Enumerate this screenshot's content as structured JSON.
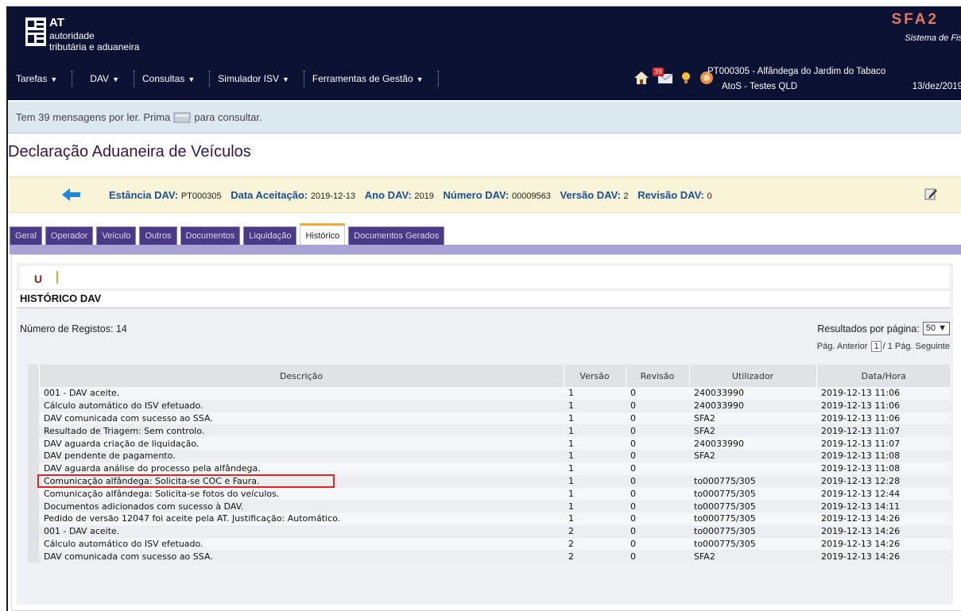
{
  "header": {
    "brand_short": "AT",
    "brand_line1": "autoridade",
    "brand_line2": "tributária e aduaneira",
    "app_title": "SFA2",
    "app_subtitle": "Sistema de Fis",
    "menu": [
      {
        "label": "Tarefas"
      },
      {
        "label": "DAV"
      },
      {
        "label": "Consultas"
      },
      {
        "label": "Simulador ISV"
      },
      {
        "label": "Ferramentas de Gestão"
      }
    ],
    "message_badge": "39",
    "user_line1": "PT000305 - Alfândega do Jardim do Tabaco",
    "user_line2": "AtoS - Testes QLD",
    "date": "13/dez/2019",
    "icons": [
      "home-icon",
      "mail-icon",
      "bulb-icon",
      "help-icon"
    ],
    "colors": {
      "topbar": "#0b1233",
      "app_title": "#e07a5f"
    }
  },
  "message_bar": {
    "text_before": "Tem 39 mensagens por ler. Prima",
    "text_after": "para consultar."
  },
  "page_title": "Declaração Aduaneira de Veículos",
  "info": {
    "estancia_label": "Estância DAV:",
    "estancia": "PT000305",
    "data_label": "Data Aceitação:",
    "data": "2019-12-13",
    "ano_label": "Ano DAV:",
    "ano": "2019",
    "numero_label": "Número DAV:",
    "numero": "00009563",
    "versao_label": "Versão DAV:",
    "versao": "2",
    "revisao_label": "Revisão DAV:",
    "revisao": "0"
  },
  "tabs": [
    {
      "label": "Geral"
    },
    {
      "label": "Operador"
    },
    {
      "label": "Veículo"
    },
    {
      "label": "Outros"
    },
    {
      "label": "Documentos"
    },
    {
      "label": "Liquidação"
    },
    {
      "label": "Histórico",
      "active": true
    },
    {
      "label": "Documentos Gerados"
    }
  ],
  "history": {
    "marker": "U",
    "title": "HISTÓRICO DAV",
    "record_count": "Número de Registos: 14",
    "per_page_label": "Resultados por página:",
    "per_page": "50",
    "pager_prev": "Pág. Anterior",
    "pager_current": "1",
    "pager_total": "/ 1",
    "pager_next": "Pág. Seguinte",
    "highlighted_row": 7,
    "columns": [
      "Descrição",
      "Versão",
      "Revisão",
      "Utilizador",
      "Data/Hora"
    ],
    "rows": [
      [
        "001 - DAV aceite.",
        "1",
        "0",
        "240033990",
        "2019-12-13 11:06"
      ],
      [
        "Cálculo automático do ISV efetuado.",
        "1",
        "0",
        "240033990",
        "2019-12-13 11:06"
      ],
      [
        "DAV comunicada com sucesso ao SSA.",
        "1",
        "0",
        "SFA2",
        "2019-12-13 11:06"
      ],
      [
        "Resultado de Triagem: Sem controlo.",
        "1",
        "0",
        "SFA2",
        "2019-12-13 11:07"
      ],
      [
        "DAV aguarda criação de liquidação.",
        "1",
        "0",
        "240033990",
        "2019-12-13 11:07"
      ],
      [
        "DAV pendente de pagamento.",
        "1",
        "0",
        "SFA2",
        "2019-12-13 11:08"
      ],
      [
        "DAV aguarda análise do processo pela alfândega.",
        "1",
        "0",
        "",
        "2019-12-13 11:08"
      ],
      [
        "Comunicação alfândega: Solicita-se COC e Faura.",
        "1",
        "0",
        "to000775/305",
        "2019-12-13 12:28"
      ],
      [
        "Comunicação alfândega: Solicita-se fotos do veículos.",
        "1",
        "0",
        "to000775/305",
        "2019-12-13 12:44"
      ],
      [
        "Documentos adicionados com sucesso à DAV.",
        "1",
        "0",
        "to000775/305",
        "2019-12-13 14:11"
      ],
      [
        "Pedido de versão 12047 foi aceite pela AT. Justificação: Automático.",
        "1",
        "0",
        "to000775/305",
        "2019-12-13 14:26"
      ],
      [
        "001 - DAV aceite.",
        "2",
        "0",
        "to000775/305",
        "2019-12-13 14:26"
      ],
      [
        "Cálculo automático do ISV efetuado.",
        "2",
        "0",
        "to000775/305",
        "2019-12-13 14:26"
      ],
      [
        "DAV comunicada com sucesso ao SSA.",
        "2",
        "0",
        "SFA2",
        "2019-12-13 14:26"
      ]
    ]
  }
}
